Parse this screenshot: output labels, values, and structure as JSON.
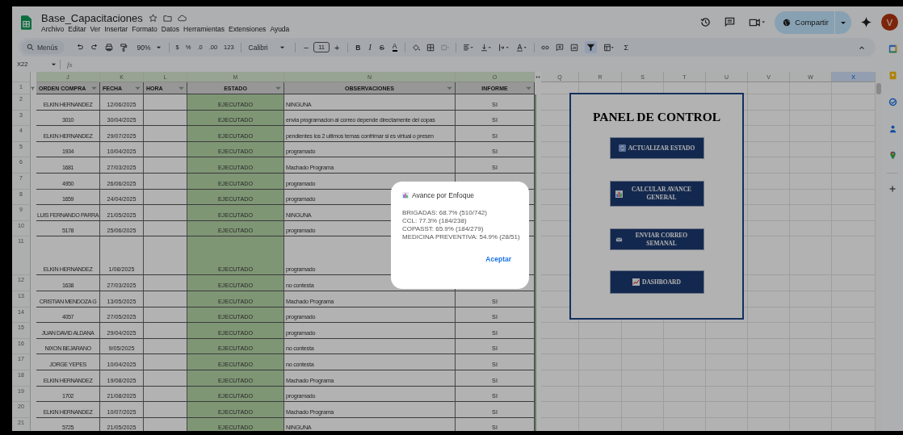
{
  "document": {
    "title": "Base_Capacitaciones",
    "menus": [
      "Archivo",
      "Editar",
      "Ver",
      "Insertar",
      "Formato",
      "Datos",
      "Herramientas",
      "Extensiones",
      "Ayuda"
    ]
  },
  "header_actions": {
    "share": "Compartir",
    "avatar": "V"
  },
  "toolbar": {
    "menus_search": "Menús",
    "zoom": "90%",
    "currency": "$",
    "percent": "%",
    "decrease_decimals": ".0",
    "increase_decimals": ".00",
    "number_format": "123",
    "font": "Calibri",
    "size_down": "−",
    "font_size": "11",
    "size_up": "+",
    "bold": "B",
    "italic": "I",
    "strikethrough": "S",
    "text_color": "A",
    "functions": "Σ"
  },
  "formula_bar": {
    "cell": "X22",
    "fx": "fx"
  },
  "columns": [
    {
      "letter": "J",
      "filtered": true,
      "selected": false,
      "hidden_before": false
    },
    {
      "letter": "K",
      "filtered": true,
      "selected": false,
      "hidden_before": false
    },
    {
      "letter": "L",
      "filtered": true,
      "selected": false,
      "hidden_before": false
    },
    {
      "letter": "M",
      "filtered": true,
      "selected": false,
      "hidden_before": false
    },
    {
      "letter": "N",
      "filtered": true,
      "selected": false,
      "hidden_before": false
    },
    {
      "letter": "O",
      "filtered": true,
      "selected": false,
      "hidden_before": false
    },
    {
      "letter": "Q",
      "filtered": false,
      "selected": false,
      "hidden_before": true
    },
    {
      "letter": "R",
      "filtered": false,
      "selected": false,
      "hidden_before": false
    },
    {
      "letter": "S",
      "filtered": false,
      "selected": false,
      "hidden_before": false
    },
    {
      "letter": "T",
      "filtered": false,
      "selected": false,
      "hidden_before": false
    },
    {
      "letter": "U",
      "filtered": false,
      "selected": false,
      "hidden_before": false
    },
    {
      "letter": "V",
      "filtered": false,
      "selected": false,
      "hidden_before": false
    },
    {
      "letter": "W",
      "filtered": false,
      "selected": false,
      "hidden_before": false
    },
    {
      "letter": "X",
      "filtered": false,
      "selected": true,
      "hidden_before": false
    }
  ],
  "header_row": {
    "number": "1",
    "cells": [
      "ORDEN COMPRA",
      "FECHA",
      "HORA",
      "ESTADO",
      "OBSERVACIONES",
      "INFORME"
    ]
  },
  "rows": [
    {
      "number": "2",
      "orden": "ELKIN HERNANDEZ",
      "fecha": "12/06/2025",
      "estado": "EJECUTADO",
      "observaciones": "NINGUNA",
      "informe": "SI",
      "tall": false
    },
    {
      "number": "3",
      "orden": "3010",
      "fecha": "30/04/2025",
      "estado": "EJECUTADO",
      "observaciones": "envia programacion al correo depende directamente del copas",
      "informe": "SI",
      "tall": false
    },
    {
      "number": "4",
      "orden": "ELKIN HERNANDEZ",
      "fecha": "29/07/2025",
      "estado": "EJECUTADO",
      "observaciones": "pendientes los 2 ultimos temas confrimar si es virtual o presen",
      "informe": "SI",
      "tall": false
    },
    {
      "number": "5",
      "orden": "1934",
      "fecha": "10/04/2025",
      "estado": "EJECUTADO",
      "observaciones": "programado",
      "informe": "SI",
      "tall": false
    },
    {
      "number": "6",
      "orden": "1681",
      "fecha": "27/03/2025",
      "estado": "EJECUTADO",
      "observaciones": "Machado Programa",
      "informe": "SI",
      "tall": false
    },
    {
      "number": "7",
      "orden": "4950",
      "fecha": "26/06/2025",
      "estado": "EJECUTADO",
      "observaciones": "programado",
      "tall": false
    },
    {
      "number": "8",
      "orden": "1659",
      "fecha": "24/04/2025",
      "estado": "EJECUTADO",
      "observaciones": "programado",
      "tall": false
    },
    {
      "number": "9",
      "orden": "LUIS FERNANDO PARRA",
      "fecha": "21/05/2025",
      "estado": "EJECUTADO",
      "observaciones": "NINGUNA",
      "tall": false
    },
    {
      "number": "10",
      "orden": "5178",
      "fecha": "25/06/2025",
      "estado": "EJECUTADO",
      "observaciones": "programado",
      "tall": false
    },
    {
      "number": "11",
      "orden": "ELKIN HERNANDEZ",
      "fecha": "1/08/2025",
      "estado": "EJECUTADO",
      "observaciones": "programado",
      "tall": true
    },
    {
      "number": "12",
      "orden": "1638",
      "fecha": "27/03/2025",
      "estado": "EJECUTADO",
      "observaciones": "no contesta",
      "tall": false
    },
    {
      "number": "13",
      "orden": "CRISTIAN MENDOZA G",
      "fecha": "13/05/2025",
      "estado": "EJECUTADO",
      "observaciones": "Machado Programa",
      "informe": "SI",
      "tall": false
    },
    {
      "number": "14",
      "orden": "4057",
      "fecha": "27/05/2025",
      "estado": "EJECUTADO",
      "observaciones": "programado",
      "informe": "SI",
      "tall": false
    },
    {
      "number": "15",
      "orden": "JUAN DAVID ALDANA",
      "fecha": "29/04/2025",
      "estado": "EJECUTADO",
      "observaciones": "programado",
      "informe": "SI",
      "tall": false
    },
    {
      "number": "16",
      "orden": "NIXON BEJARANO",
      "fecha": "9/05/2025",
      "estado": "EJECUTADO",
      "observaciones": "no contesta",
      "informe": "SI",
      "tall": false
    },
    {
      "number": "17",
      "orden": "JORGE YEPES",
      "fecha": "10/04/2025",
      "estado": "EJECUTADO",
      "observaciones": "no contesta",
      "informe": "SI",
      "tall": false
    },
    {
      "number": "18",
      "orden": "ELKIN HERNANDEZ",
      "fecha": "19/08/2025",
      "estado": "EJECUTADO",
      "observaciones": "Machado Programa",
      "informe": "SI",
      "tall": false
    },
    {
      "number": "19",
      "orden": "1702",
      "fecha": "21/08/2025",
      "estado": "EJECUTADO",
      "observaciones": "programado",
      "informe": "SI",
      "tall": false
    },
    {
      "number": "20",
      "orden": "ELKIN HERNANDEZ",
      "fecha": "10/07/2025",
      "estado": "EJECUTADO",
      "observaciones": "Machado Programa",
      "informe": "SI",
      "tall": false
    },
    {
      "number": "21",
      "orden": "5725",
      "fecha": "21/05/2025",
      "estado": "EJECUTADO",
      "observaciones": "NINGUNA",
      "informe": "SI",
      "tall": false
    }
  ],
  "control_panel": {
    "title": "PANEL DE CONTROL",
    "buttons": [
      {
        "kind": "update",
        "label": "ACTUALIZAR ESTADO"
      },
      {
        "kind": "calculate",
        "label": "CALCULAR AVANCE GENERAL"
      },
      {
        "kind": "email",
        "label": "ENVIAR CORREO SEMANAL"
      },
      {
        "kind": "dashboard",
        "label": "DASHBOARD"
      }
    ]
  },
  "dialog": {
    "title": "Avance por Enfoque",
    "lines": [
      "BRIGADAS: 68.7% (510/742)",
      "CCL: 77.3% (184/238)",
      "COPASST: 65.9% (184/279)",
      "MEDICINA PREVENTIVA: 54.9% (28/51)"
    ],
    "button": "Aceptar"
  }
}
